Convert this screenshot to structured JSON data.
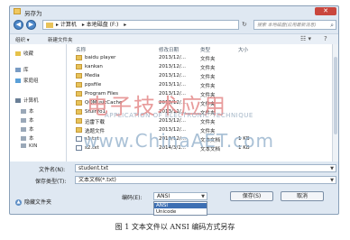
{
  "window": {
    "title": "另存为",
    "close": "✕"
  },
  "address": {
    "back": "◀",
    "forward": "▶",
    "crumbs": [
      "▸ 计算机",
      "▸ 本地磁盘 (F:)",
      "▸"
    ],
    "refresh": "↻",
    "search_placeholder": "搜索 本地磁盘(应用最新消息)",
    "search_icon": "search-icon"
  },
  "toolbar": {
    "organize": "组织 ▾",
    "new_folder": "新建文件夹",
    "view": "☷ ▾",
    "help": "?"
  },
  "nav": {
    "items": [
      "收藏",
      "库",
      "家庭组",
      "计算机",
      "本",
      "本",
      "本",
      "本",
      "KIN"
    ]
  },
  "columns": {
    "name": "名称",
    "date": "修改日期",
    "type": "类型",
    "size": "大小"
  },
  "files": [
    {
      "name": "baidu player",
      "date": "2013/12/...",
      "type": "文件夹",
      "size": "",
      "icon": "folder-icon"
    },
    {
      "name": "kankan",
      "date": "2013/12/...",
      "type": "文件夹",
      "size": "",
      "icon": "folder-icon"
    },
    {
      "name": "Media",
      "date": "2013/12/...",
      "type": "文件夹",
      "size": "",
      "icon": "folder-icon"
    },
    {
      "name": "ppsfile",
      "date": "2013/11/...",
      "type": "文件夹",
      "size": "",
      "icon": "folder-icon"
    },
    {
      "name": "Program Files",
      "date": "2013/12/...",
      "type": "文件夹",
      "size": "",
      "icon": "folder-icon"
    },
    {
      "name": "QQMusicCache",
      "date": "2013/12/...",
      "type": "文件夹",
      "size": "",
      "icon": "folder-icon"
    },
    {
      "name": "Stuinfo1",
      "date": "2013/11/...",
      "type": "文件夹",
      "size": "",
      "icon": "folder-icon"
    },
    {
      "name": "迅雷下载",
      "date": "2013/12/...",
      "type": "文件夹",
      "size": "",
      "icon": "folder-icon"
    },
    {
      "name": "选题文件",
      "date": "2013/12/...",
      "type": "文件夹",
      "size": "",
      "icon": "folder-icon"
    },
    {
      "name": "s1.txt",
      "date": "2013/12/...",
      "type": "文本文档",
      "size": "1 KB",
      "icon": "text-file-icon"
    },
    {
      "name": "s2.txt",
      "date": "2014/3/1...",
      "type": "文本文档",
      "size": "1 KB",
      "icon": "text-file-icon"
    }
  ],
  "filename": {
    "label": "文件名(N):",
    "value": "student.txt"
  },
  "savetype": {
    "label": "保存类型(T):",
    "value": "文本文档(*.txt)"
  },
  "hide_folders": "隐藏文件夹",
  "encoding": {
    "label": "编码(E):",
    "value": "ANSI",
    "options": [
      "ANSI",
      "Unicode"
    ]
  },
  "buttons": {
    "save": "保存(S)",
    "cancel": "取消"
  },
  "watermarks": {
    "cn": "电子技术应用",
    "en": "APPLICATION OF ELECTRONIC TECHNIQUE",
    "url": "www.ChinaAET.com"
  },
  "caption": "图 1 文本文件以 ANSI 编码方式另存"
}
